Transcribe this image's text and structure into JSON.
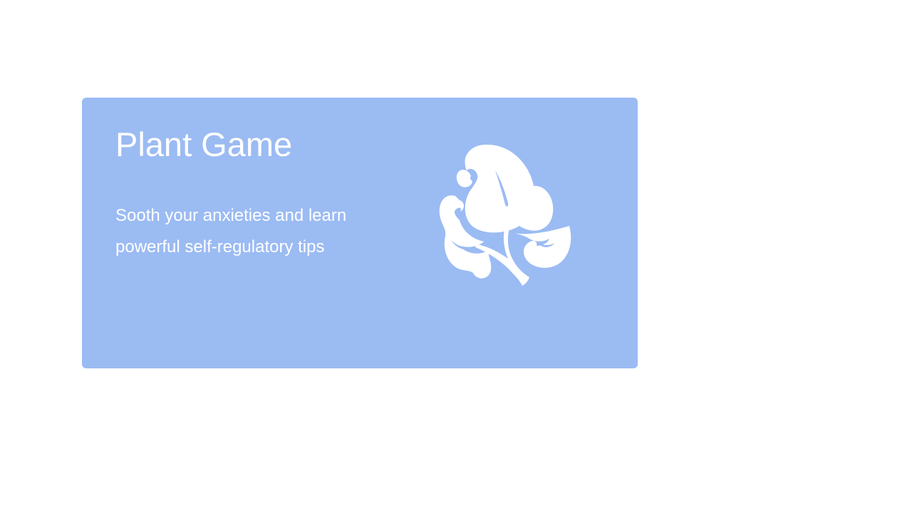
{
  "card": {
    "title": "Plant Game",
    "description": "Sooth your anxieties and learn powerful self-regulatory tips",
    "icon": "plant-leaves-icon",
    "background_color": "#9bbbf3",
    "text_color": "#ffffff"
  }
}
